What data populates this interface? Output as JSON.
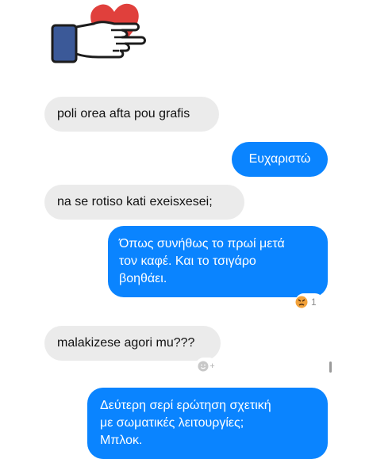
{
  "sticker": {
    "icon": "hand-holding-heart-icon",
    "heart_color": "#e0403c",
    "sleeve_color": "#3b5998"
  },
  "messages": [
    {
      "side": "received",
      "text": "poli orea afta pou grafis"
    },
    {
      "side": "sent",
      "text": "Ευχαριστώ"
    },
    {
      "side": "received",
      "text": "na se rotiso kati exeisxesei;"
    },
    {
      "side": "sent",
      "lines": [
        "Όπως συνήθως το πρωί μετά",
        "τον καφέ. Και το τσιγάρο",
        "βοηθάει."
      ],
      "reaction": {
        "icon": "angry-face-icon",
        "count": "1"
      }
    },
    {
      "side": "received",
      "text": "malakizese agori mu???",
      "reaction_add": {
        "icon": "add-reaction-icon",
        "label": "+"
      }
    },
    {
      "side": "sent",
      "lines": [
        "Δεύτερη σερί ερώτηση σχετική",
        "με σωματικές λειτουργίες;",
        "Μπλοκ."
      ]
    }
  ],
  "colors": {
    "sent_bubble": "#0a84ff",
    "received_bubble": "#ebebeb"
  }
}
